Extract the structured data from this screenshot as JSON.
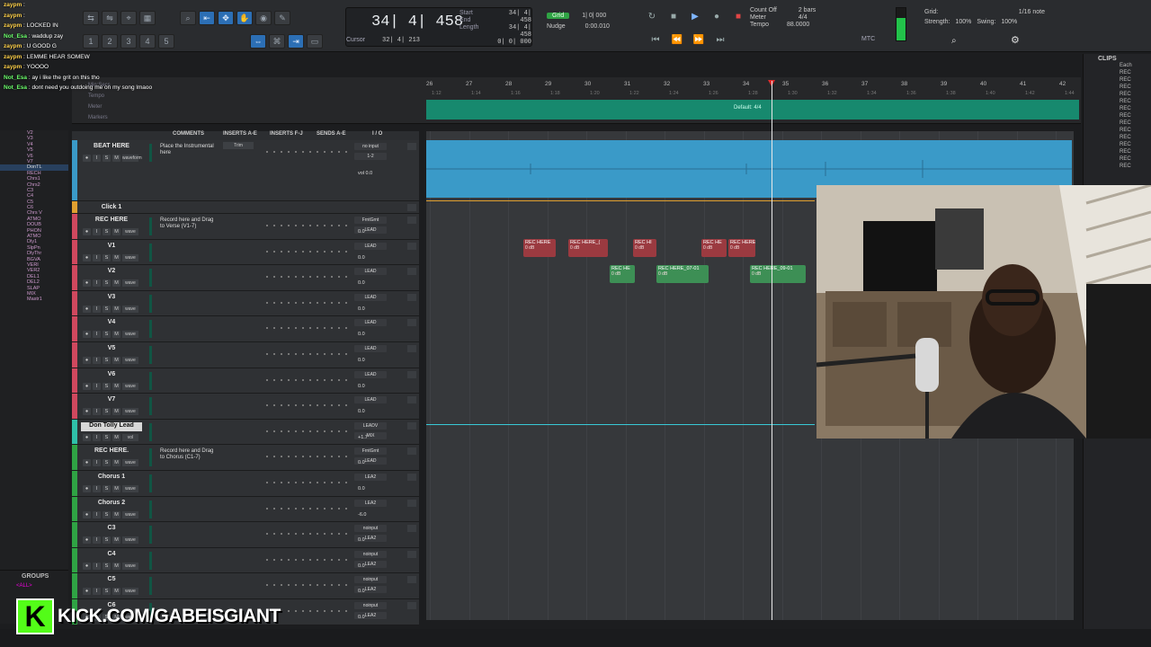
{
  "chat": [
    {
      "user": "zaypm",
      "text": ""
    },
    {
      "user": "zaypm",
      "text": ""
    },
    {
      "user": "zaypm",
      "text": "LOCKED IN"
    },
    {
      "user": "Not_Esa",
      "text": "waddup zay"
    },
    {
      "user": "zaypm",
      "text": "U GOOD G"
    },
    {
      "user": "zaypm",
      "text": "LEMME HEAR SOMEW"
    },
    {
      "user": "zaypm",
      "text": "YOOOO"
    },
    {
      "user": "Not_Esa",
      "text": "ay i like the grit on this tho"
    },
    {
      "user": "Not_Esa",
      "text": "dont need you outdoing me on my song lmaoo"
    }
  ],
  "counter": {
    "main": "34| 4| 458",
    "cursor_label": "Cursor",
    "cursor_value": "32| 4| 213",
    "start_label": "Start",
    "end_label": "End",
    "length_label": "Length",
    "start_value": "34| 4| 458",
    "end_value": "34| 4| 458",
    "length_value": "0| 0| 000"
  },
  "grid_nudge": {
    "grid_label": "Grid",
    "grid_value": "1| 0| 000",
    "nudge_label": "Nudge",
    "nudge_value": "0:00.010"
  },
  "count_off": {
    "label": "Count Off",
    "meter_label": "Meter",
    "tempo_label": "Tempo",
    "bars": "2 bars",
    "meter": "4/4",
    "tempo": "88.0000"
  },
  "grid_panel": {
    "grid_label": "Grid:",
    "grid_value": "1/16 note",
    "strength_label": "Strength:",
    "strength_value": "100%",
    "swing_label": "Swing:",
    "swing_value": "100%"
  },
  "mtc_label": "MTC",
  "ruler": {
    "labels": [
      "Min:Secs",
      "Tempo",
      "Meter",
      "Markers"
    ],
    "bars": [
      "26",
      "27",
      "28",
      "29",
      "30",
      "31",
      "32",
      "33",
      "34",
      "35",
      "36",
      "37",
      "38",
      "39",
      "40",
      "41",
      "42"
    ],
    "subs": [
      "1:12",
      "1:14",
      "1:16",
      "1:18",
      "1:20",
      "1:22",
      "1:24",
      "1:26",
      "1:28",
      "1:30",
      "1:32",
      "1:34",
      "1:36",
      "1:38",
      "1:40",
      "1:42",
      "1:44"
    ],
    "meter_text": "Default: 4/4"
  },
  "columns": {
    "comments": "COMMENTS",
    "inserts_ae": "INSERTS A-E",
    "inserts_fj": "INSERTS F-J",
    "sends": "SENDS A-E",
    "io": "I / O"
  },
  "tracks": [
    {
      "name": "BEAT HERE",
      "color": "#3a9ac8",
      "comment": "Place the Instrumental here",
      "ins": "Trim",
      "io1": "no input",
      "io2": "1-2",
      "vol": "vol 0.0",
      "mode": "waveform"
    },
    {
      "name": "Click 1",
      "color": "#e0a030",
      "comment": "",
      "ins": "",
      "io1": "",
      "io2": "",
      "vol": "",
      "mode": ""
    },
    {
      "name": "REC HERE",
      "color": "#d0485e",
      "comment": "Record here and Drag to Verse (V1-7)",
      "ins": "",
      "io1": "FrntGrnt",
      "io2": "LEAD",
      "vol": "0.0",
      "mode": "wave"
    },
    {
      "name": "V1",
      "color": "#d0485e",
      "comment": "",
      "ins": "",
      "io1": "LEAD",
      "io2": "",
      "vol": "0.0",
      "mode": "wave"
    },
    {
      "name": "V2",
      "color": "#d0485e",
      "comment": "",
      "ins": "",
      "io1": "LEAD",
      "io2": "",
      "vol": "0.0",
      "mode": "wave"
    },
    {
      "name": "V3",
      "color": "#d0485e",
      "comment": "",
      "ins": "",
      "io1": "LEAD",
      "io2": "",
      "vol": "0.0",
      "mode": "wave"
    },
    {
      "name": "V4",
      "color": "#d0485e",
      "comment": "",
      "ins": "",
      "io1": "LEAD",
      "io2": "",
      "vol": "0.0",
      "mode": "wave"
    },
    {
      "name": "V5",
      "color": "#d0485e",
      "comment": "",
      "ins": "",
      "io1": "LEAD",
      "io2": "",
      "vol": "0.0",
      "mode": "wave"
    },
    {
      "name": "V6",
      "color": "#d0485e",
      "comment": "",
      "ins": "",
      "io1": "LEAD",
      "io2": "",
      "vol": "0.0",
      "mode": "wave"
    },
    {
      "name": "V7",
      "color": "#d0485e",
      "comment": "",
      "ins": "",
      "io1": "LEAD",
      "io2": "",
      "vol": "0.0",
      "mode": "wave"
    },
    {
      "name": "Don Tolly Lead",
      "color": "#2fbfa8",
      "comment": "",
      "ins": "",
      "io1": "LEADV",
      "io2": "MIX",
      "vol": "+1.7",
      "mode": "vol"
    },
    {
      "name": "REC HERE.",
      "color": "#2fa344",
      "comment": "Record here and Drag to Chorus (C1-7)",
      "ins": "",
      "io1": "FrntGrnt",
      "io2": "LEAD",
      "vol": "0.0",
      "mode": "wave"
    },
    {
      "name": "Chorus 1",
      "color": "#2fa344",
      "comment": "",
      "ins": "",
      "io1": "LEA2",
      "io2": "",
      "vol": "0.0",
      "mode": "wave"
    },
    {
      "name": "Chorus 2",
      "color": "#2fa344",
      "comment": "",
      "ins": "",
      "io1": "LEA2",
      "io2": "",
      "vol": "-6.0",
      "mode": "wave"
    },
    {
      "name": "C3",
      "color": "#2fa344",
      "comment": "",
      "ins": "",
      "io1": "noinput",
      "io2": "LEA2",
      "vol": "0.0",
      "mode": "wave"
    },
    {
      "name": "C4",
      "color": "#2fa344",
      "comment": "",
      "ins": "",
      "io1": "noinput",
      "io2": "LEA2",
      "vol": "0.0",
      "mode": "wave"
    },
    {
      "name": "C5",
      "color": "#2fa344",
      "comment": "",
      "ins": "",
      "io1": "noinput",
      "io2": "LEA2",
      "vol": "0.0",
      "mode": "wave"
    },
    {
      "name": "C6",
      "color": "#2fa344",
      "comment": "",
      "ins": "",
      "io1": "noinput",
      "io2": "LEA2",
      "vol": "0.0",
      "mode": "wave"
    }
  ],
  "tracklist": [
    "V2",
    "V3",
    "V4",
    "V5",
    "V6",
    "V7",
    "DonTL",
    "RECH",
    "Chrs1",
    "Chrs2",
    "C3",
    "C4",
    "C5",
    "C6",
    "Chrs V",
    "ATMO",
    "DOUB",
    "PHON",
    "ATMO",
    "Dly1",
    "SlpPn",
    "DlyThr",
    "BGVA",
    "VERI",
    "VER2",
    "DEL1",
    "DEL2",
    "SLAP",
    "MIX",
    "Mastr1"
  ],
  "clips": {
    "red": [
      {
        "label": "REC HERE",
        "db": "0 dB"
      },
      {
        "label": "REC HERE_(",
        "db": "0 dB"
      },
      {
        "label": "REC HI",
        "db": "0 dB"
      },
      {
        "label": "REC HE",
        "db": "0 dB"
      },
      {
        "label": "REC HERE",
        "db": "0 dB"
      }
    ],
    "green": [
      {
        "label": "REC HE",
        "db": "0 dB"
      },
      {
        "label": "REC HERE_07-01",
        "db": "0 dB"
      },
      {
        "label": "REC HERE_09-01",
        "db": "0 dB"
      }
    ]
  },
  "clips_panel": {
    "title": "CLIPS",
    "items": [
      "Each",
      "REC",
      "REC",
      "REC",
      "REC",
      "REC",
      "REC",
      "REC",
      "REC",
      "REC",
      "REC",
      "REC",
      "REC",
      "REC",
      "REC"
    ]
  },
  "groups": {
    "title": "GROUPS",
    "all": "<ALL>"
  },
  "brand": {
    "logo": "K",
    "url": "KICK.COM/GABEISGIANT"
  },
  "colors": {
    "accent": "#2c6fb5",
    "kick_green": "#53fc18",
    "tempo_strip": "#17896e"
  }
}
